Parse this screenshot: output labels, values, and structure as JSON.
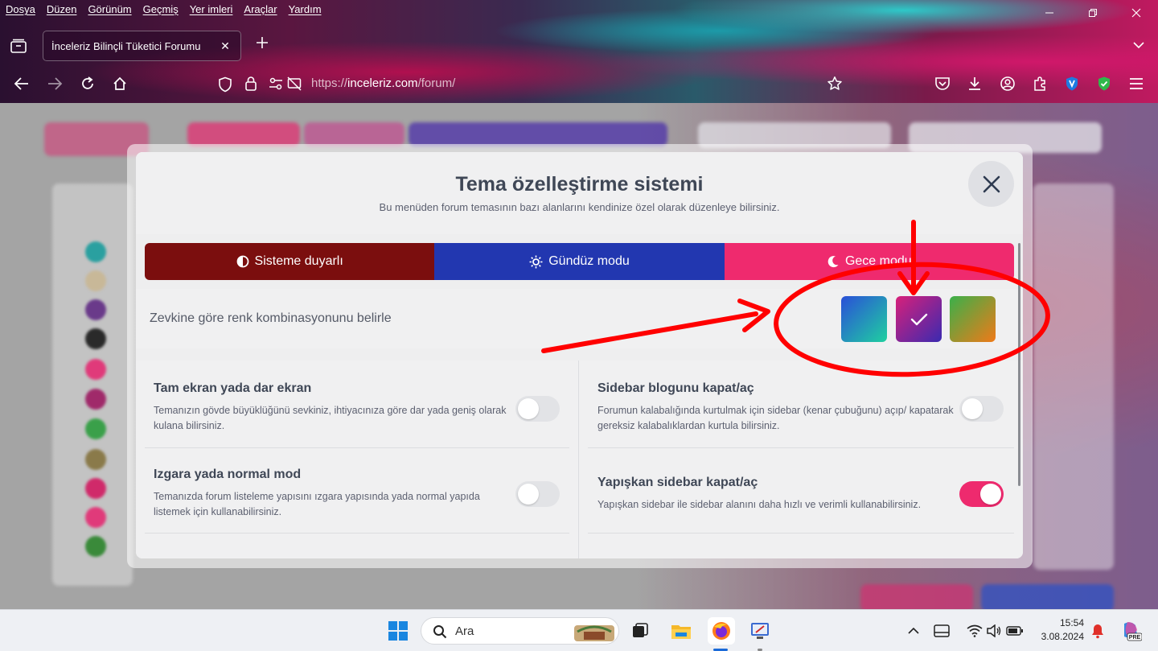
{
  "browser": {
    "menu": [
      "Dosya",
      "Düzen",
      "Görünüm",
      "Geçmiş",
      "Yer imleri",
      "Araçlar",
      "Yardım"
    ],
    "tab_title": "İnceleriz Bilinçli Tüketici Forumu",
    "url_prefix": "https://",
    "url_host": "inceleriz.com",
    "url_path": "/forum/"
  },
  "modal": {
    "title": "Tema özelleştirme sistemi",
    "subtitle": "Bu menüden forum temasının bazı alanlarını kendinize özel olarak düzenleye bilirsiniz.",
    "modes": [
      {
        "label": "Sisteme duyarlı",
        "icon": "half-circle-icon",
        "color": "#7b0e0e"
      },
      {
        "label": "Gündüz modu",
        "icon": "sun-icon",
        "color": "#2237b0"
      },
      {
        "label": "Gece modu",
        "icon": "moon-icon",
        "color": "#ef2a6e"
      }
    ],
    "combo_label": "Zevkine göre renk kombinasyonunu belirle",
    "swatches": [
      {
        "name": "blue-green",
        "selected": false
      },
      {
        "name": "pink-purple",
        "selected": true
      },
      {
        "name": "green-orange",
        "selected": false
      }
    ],
    "settings": {
      "fullscreen": {
        "title": "Tam ekran yada dar ekran",
        "desc": "Temanızın gövde büyüklüğünü sevkiniz, ihtiyacınıza göre dar yada geniş olarak kulana bilirsiniz.",
        "on": false
      },
      "grid": {
        "title": "Izgara yada normal mod",
        "desc": "Temanızda forum listeleme yapısını ızgara yapısında yada normal yapıda listemek için kullanabilirsiniz.",
        "on": false
      },
      "sidebar": {
        "title": "Sidebar blogunu kapat/aç",
        "desc": "Forumun kalabalığında kurtulmak için sidebar (kenar çubuğunu) açıp/ kapatarak gereksiz kalabalıklardan kurtula bilirsiniz.",
        "on": false
      },
      "sticky": {
        "title": "Yapışkan sidebar kapat/aç",
        "desc": "Yapışkan sidebar ile sidebar alanını daha hızlı ve verimli kullanabilirsiniz.",
        "on": true
      }
    }
  },
  "taskbar": {
    "search_placeholder": "Ara",
    "time": "15:54",
    "date": "3.08.2024"
  },
  "colors": {
    "accent": "#ee2a6e",
    "annotation": "#ff0000"
  }
}
